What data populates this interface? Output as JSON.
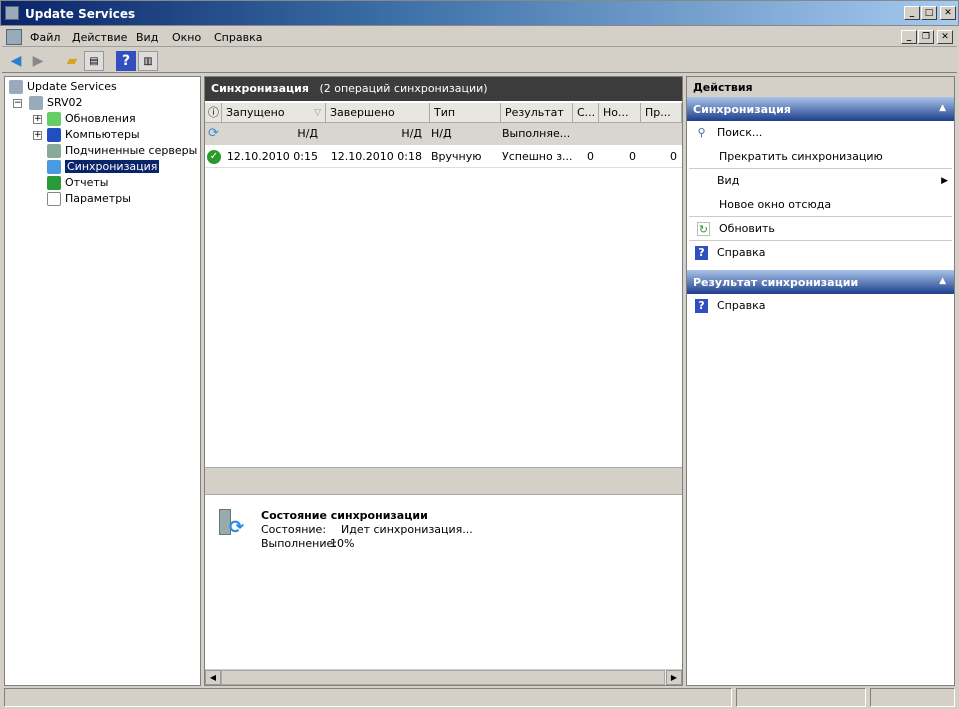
{
  "window": {
    "title": "Update Services"
  },
  "menu": [
    "Файл",
    "Действие",
    "Вид",
    "Окно",
    "Справка"
  ],
  "tree": {
    "root": "Update Services",
    "server": "SRV02",
    "items": [
      "Обновления",
      "Компьютеры",
      "Подчиненные серверы",
      "Синхронизация",
      "Отчеты",
      "Параметры"
    ],
    "selected": "Синхронизация"
  },
  "center": {
    "title": "Синхронизация",
    "subtitle": "(2 операций синхронизации)",
    "columns": [
      "Запущено",
      "Завершено",
      "Тип",
      "Результат",
      "С...",
      "Но...",
      "Пр..."
    ],
    "rows": [
      {
        "status": "in-progress",
        "started": "Н/Д",
        "finished": "Н/Д",
        "type": "Н/Д",
        "result": "Выполняе...",
        "c": "",
        "n": "",
        "p": ""
      },
      {
        "status": "success",
        "started": "12.10.2010 0:15",
        "finished": "12.10.2010 0:18",
        "type": "Вручную",
        "result": "Успешно з...",
        "c": "0",
        "n": "0",
        "p": "0"
      }
    ],
    "detail": {
      "title": "Состояние синхронизации",
      "state_label": "Состояние:",
      "state_value": "Идет синхронизация...",
      "progress_label": "Выполнение:",
      "progress_value": "10%"
    }
  },
  "actions": {
    "header": "Действия",
    "section1": {
      "title": "Синхронизация",
      "items": [
        "Поиск...",
        "Прекратить синхронизацию",
        "Вид",
        "Новое окно отсюда",
        "Обновить",
        "Справка"
      ]
    },
    "section2": {
      "title": "Результат синхронизации",
      "items": [
        "Справка"
      ]
    }
  }
}
